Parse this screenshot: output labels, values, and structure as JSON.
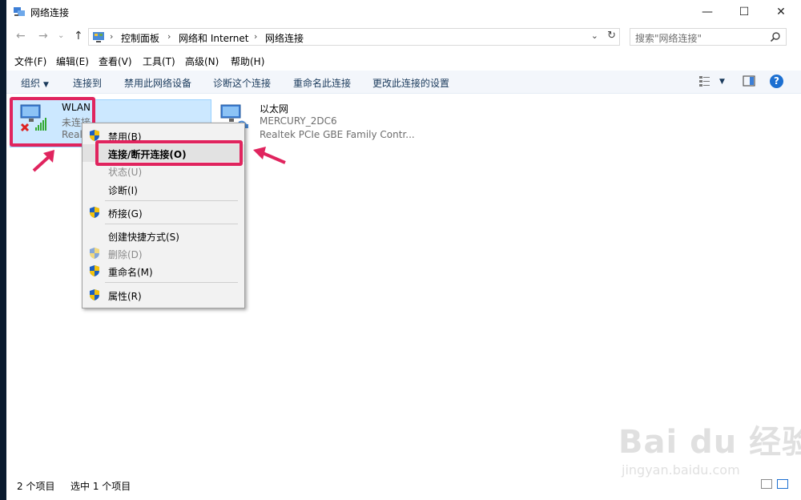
{
  "window": {
    "title": "网络连接",
    "controls": {
      "minimize": "—",
      "maximize": "☐",
      "close": "✕"
    }
  },
  "nav": {
    "back": "←",
    "forward": "→",
    "recent": "⌄",
    "up": "↑",
    "breadcrumbs": [
      "控制面板",
      "网络和 Internet",
      "网络连接"
    ],
    "search_placeholder": "搜索\"网络连接\""
  },
  "menubar": [
    "文件(F)",
    "编辑(E)",
    "查看(V)",
    "工具(T)",
    "高级(N)",
    "帮助(H)"
  ],
  "commands": {
    "organize": "组织",
    "items": [
      "连接到",
      "禁用此网络设备",
      "诊断这个连接",
      "重命名此连接",
      "更改此连接的设置"
    ],
    "help": "?"
  },
  "connections": [
    {
      "name": "WLAN",
      "status": "未连接",
      "adapter": "Real",
      "state": "disconnected",
      "selected": true
    },
    {
      "name": "以太网",
      "status": "MERCURY_2DC6",
      "adapter": "Realtek PCIe GBE Family Contr...",
      "state": "connected",
      "selected": false
    }
  ],
  "context_menu": [
    {
      "label": "禁用(B)",
      "shield": true,
      "disabled": false,
      "bold": false
    },
    {
      "label": "连接/断开连接(O)",
      "shield": false,
      "disabled": false,
      "bold": true
    },
    {
      "label": "状态(U)",
      "shield": false,
      "disabled": true,
      "bold": false
    },
    {
      "label": "诊断(I)",
      "shield": false,
      "disabled": false,
      "bold": false
    },
    {
      "label": "桥接(G)",
      "shield": true,
      "disabled": false,
      "bold": false
    },
    {
      "label": "创建快捷方式(S)",
      "shield": false,
      "disabled": false,
      "bold": false
    },
    {
      "label": "删除(D)",
      "shield": true,
      "disabled": true,
      "bold": false
    },
    {
      "label": "重命名(M)",
      "shield": true,
      "disabled": false,
      "bold": false
    },
    {
      "label": "属性(R)",
      "shield": true,
      "disabled": false,
      "bold": false
    }
  ],
  "status": {
    "count": "2 个项目",
    "selected": "选中 1 个项目"
  },
  "watermark": {
    "brand": "Bai du 经验",
    "url": "jingyan.baidu.com"
  },
  "colors": {
    "accent": "#1c6fd1",
    "selection": "#cce8ff",
    "highlight_box": "#e0245e"
  }
}
